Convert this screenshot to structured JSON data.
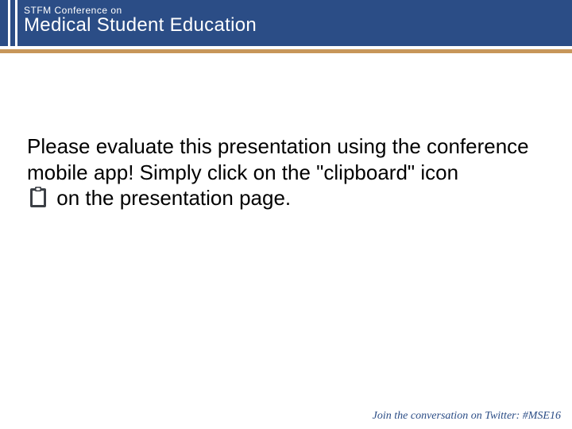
{
  "header": {
    "kicker": "STFM Conference on",
    "title": "Medical Student Education"
  },
  "body": {
    "part1": "Please evaluate this presentation using the conference mobile app! Simply click on the \"clipboard\" icon",
    "part2": "on the presentation page.",
    "icon_name": "clipboard-icon"
  },
  "footer": {
    "text": "Join the conversation on Twitter: #MSE16"
  },
  "colors": {
    "header_bg": "#2b4d86",
    "accent": "#c7965a"
  }
}
